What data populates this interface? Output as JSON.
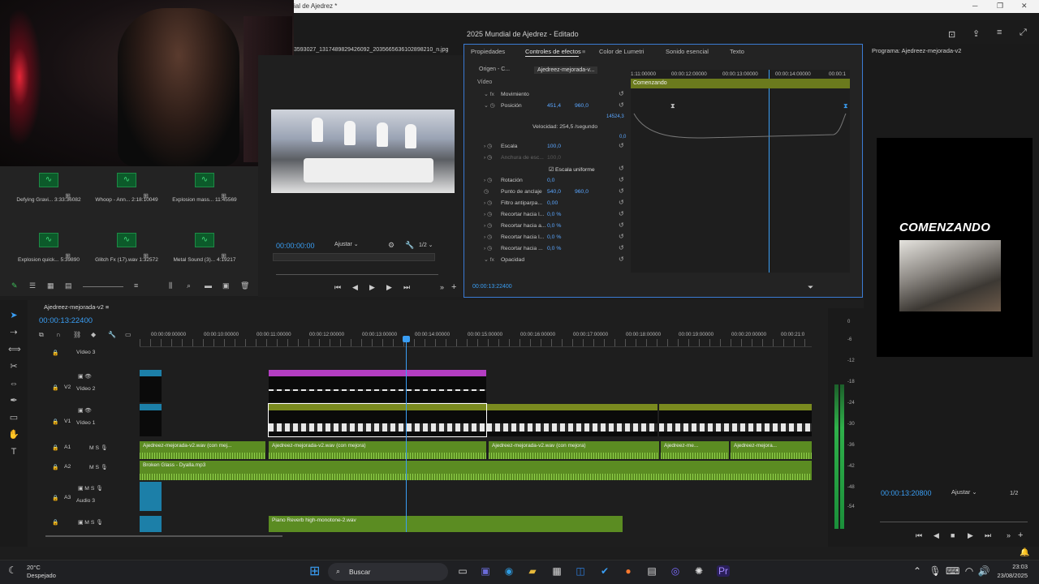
{
  "window": {
    "title": "ial de Ajedrez *",
    "min": "─",
    "max": "❐",
    "close": "✕"
  },
  "app_title": "2025 Mundial de Ajedrez - Editado",
  "bin": {
    "items": [
      {
        "name": "Defying Gravi...",
        "dur": "3:33:36082"
      },
      {
        "name": "Whoop - Ann...",
        "dur": "2:18:10049"
      },
      {
        "name": "Explosion mass...",
        "dur": "11:45569"
      },
      {
        "name": "Explosion quick...",
        "dur": "5:39890"
      },
      {
        "name": "Glitch Fx (17).wav",
        "dur": "1:32572"
      },
      {
        "name": "Metal Sound (3)...",
        "dur": "4:19217"
      }
    ]
  },
  "source": {
    "filename": "3593027_1317489829426092_2035665636102898210_n.jpg",
    "timecode": "00:00:00:00",
    "fit": "Ajustar",
    "ratio": "1/2"
  },
  "effect_controls": {
    "tabs": [
      "Propiedades",
      "Controles de efectos",
      "Color de Lumetri",
      "Sonido esencial",
      "Texto"
    ],
    "source_label": "Origen - C...",
    "clip_label": "Ajedreez-mejorada-v...",
    "section": "Vídeo",
    "rows": [
      {
        "label": "Movimiento",
        "v1": "",
        "v2": ""
      },
      {
        "label": "Posición",
        "v1": "451,4",
        "v2": "960,0"
      },
      {
        "label": "Velocidad: 254,5 /segundo",
        "v1": "",
        "v2": ""
      },
      {
        "label": "Escala",
        "v1": "100,0",
        "v2": ""
      },
      {
        "label": "Anchura de esc...",
        "v1": "100,0",
        "v2": ""
      },
      {
        "label": "Escala uniforme",
        "v1": "",
        "v2": ""
      },
      {
        "label": "Rotación",
        "v1": "0,0",
        "v2": ""
      },
      {
        "label": "Punto de anclaje",
        "v1": "540,0",
        "v2": "960,0"
      },
      {
        "label": "Filtro antiparpa...",
        "v1": "0,00",
        "v2": ""
      },
      {
        "label": "Recortar hacia l...",
        "v1": "0,0 %",
        "v2": ""
      },
      {
        "label": "Recortar hacia a...",
        "v1": "0,0 %",
        "v2": ""
      },
      {
        "label": "Recortar hacia l...",
        "v1": "0,0 %",
        "v2": ""
      },
      {
        "label": "Recortar hacia ...",
        "v1": "0,0 %",
        "v2": ""
      },
      {
        "label": "Opacidad",
        "v1": "",
        "v2": ""
      }
    ],
    "graph_max": "14524,3",
    "graph_min": "0,0",
    "ruler": [
      "1:11:00000",
      "00:00:12:00000",
      "00:00:13:00000",
      "00:00:14:00000",
      "00:00:1"
    ],
    "clip_name": "Comenzando",
    "timecode": "00:00:13:22400"
  },
  "program": {
    "title": "Programa: Ajedreez-mejorada-v2",
    "banner": "COMENZANDO",
    "timecode": "00:00:13:20800",
    "fit": "Ajustar",
    "ratio": "1/2"
  },
  "timeline": {
    "sequence": "Ajedreez-mejorada-v2",
    "timecode": "00:00:13:22400",
    "ruler": [
      "00:00:09:00000",
      "00:00:10:00000",
      "00:00:11:00000",
      "00:00:12:00000",
      "00:00:13:00000",
      "00:00:14:00000",
      "00:00:15:00000",
      "00:00:16:00000",
      "00:00:17:00000",
      "00:00:18:00000",
      "00:00:19:00000",
      "00:00:20:00000",
      "00:00:21:0"
    ],
    "tracks": [
      {
        "id": "V3",
        "name": "Vídeo 3"
      },
      {
        "id": "V2",
        "name": "Vídeo 2"
      },
      {
        "id": "V1",
        "name": "Vídeo 1"
      },
      {
        "id": "A1",
        "name": ""
      },
      {
        "id": "A2",
        "name": ""
      },
      {
        "id": "A3",
        "name": "Audio 3"
      }
    ],
    "audio_clips": [
      "Ajedreez-mejorada-v2.wav (con mej...",
      "Ajedreez-mejorada-v2.wav (con mejora)",
      "Ajedreez-mejorada-v2.wav (con mejora)",
      "Ajedreez-me...",
      "Ajedreez-mejora...",
      "Broken Glass - Dyalla.mp3",
      "Piano Reverb high-monotone-2.wav"
    ],
    "meter_labels": [
      "0",
      "-6",
      "-12",
      "-18",
      "-24",
      "-30",
      "-36",
      "-42",
      "-48",
      "-54"
    ]
  },
  "taskbar": {
    "temp": "20°C",
    "weather": "Despejado",
    "search": "Buscar",
    "time": "23:03",
    "date": "23/08/2025"
  }
}
